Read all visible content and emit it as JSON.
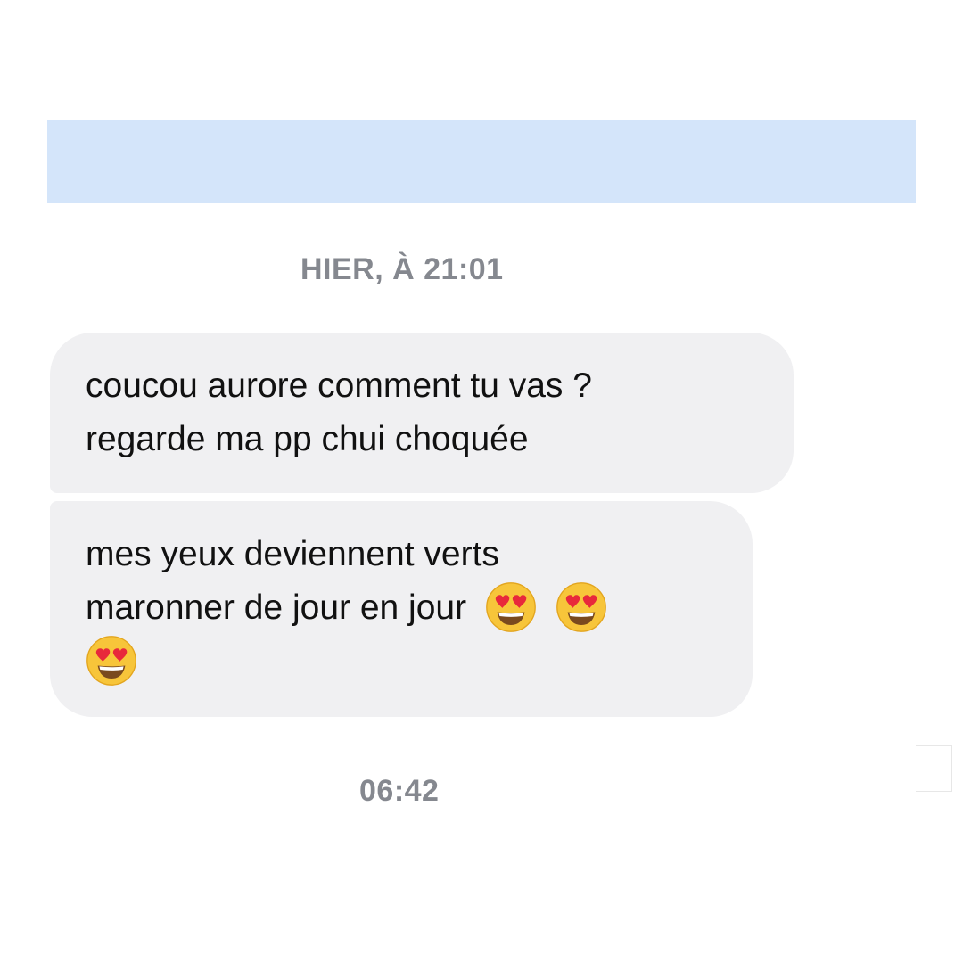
{
  "header": {
    "banner_color": "#d4e5fa"
  },
  "conversation": {
    "timestamp_yesterday": "HIER, À 21:01",
    "timestamp_today": "06:42",
    "messages": [
      {
        "lines": [
          "coucou aurore comment tu vas ?",
          "regarde ma pp chui choquée"
        ]
      },
      {
        "lines": [
          "mes yeux deviennent verts",
          "maronner de jour en jour"
        ],
        "emojis": [
          "heart-eyes-emoji",
          "heart-eyes-emoji",
          "heart-eyes-emoji"
        ]
      }
    ]
  },
  "colors": {
    "bubble_background": "#f0f0f2",
    "timestamp_text": "#85888f",
    "message_text": "#111111"
  }
}
